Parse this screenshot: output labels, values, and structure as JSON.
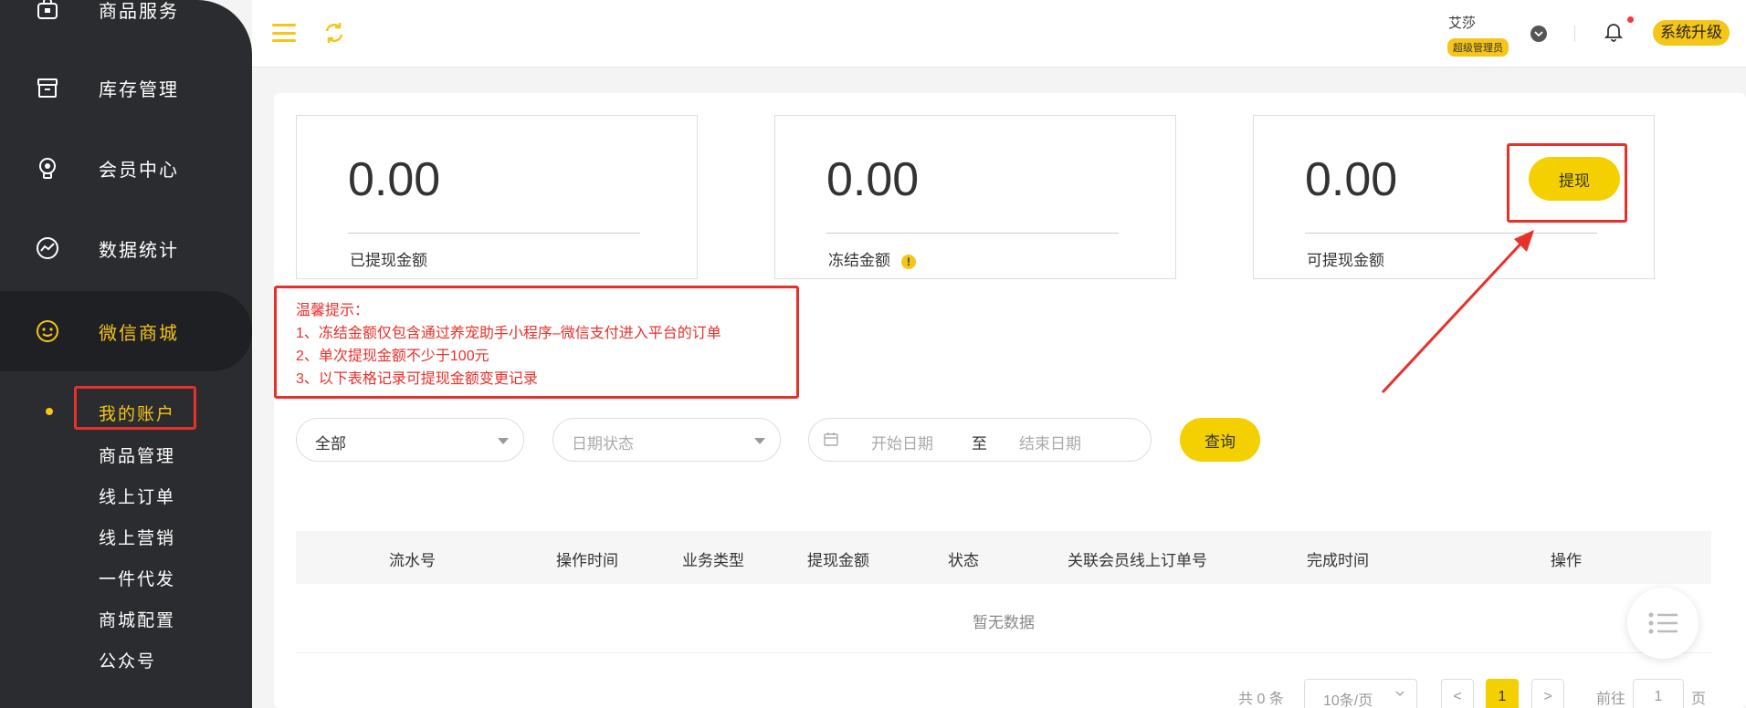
{
  "sidebar": {
    "items": [
      {
        "label": "商品服务",
        "icon": "bag-icon"
      },
      {
        "label": "库存管理",
        "icon": "inventory-icon"
      },
      {
        "label": "会员中心",
        "icon": "member-icon"
      },
      {
        "label": "数据统计",
        "icon": "chart-icon"
      },
      {
        "label": "微信商城",
        "icon": "wechat-icon"
      }
    ],
    "sub_items": [
      {
        "label": "我的账户"
      },
      {
        "label": "商品管理"
      },
      {
        "label": "线上订单"
      },
      {
        "label": "线上营销"
      },
      {
        "label": "一件代发"
      },
      {
        "label": "商城配置"
      },
      {
        "label": "公众号"
      }
    ]
  },
  "header": {
    "user_name": "艾莎",
    "user_role": "超级管理员",
    "upgrade_label": "系统升级"
  },
  "cards": [
    {
      "amount": "0.00",
      "label": "已提现金额"
    },
    {
      "amount": "0.00",
      "label": "冻结金额"
    },
    {
      "amount": "0.00",
      "label": "可提现金额"
    }
  ],
  "withdraw_label": "提现",
  "notice": {
    "title": "温馨提示：",
    "lines": [
      "1、冻结金额仅包含通过养宠助手小程序–微信支付进入平台的订单",
      "2、单次提现金额不少于100元",
      "3、以下表格记录可提现金额变更记录"
    ]
  },
  "filters": {
    "type_value": "全部",
    "date_status_placeholder": "日期状态",
    "start_date_placeholder": "开始日期",
    "to_label": "至",
    "end_date_placeholder": "结束日期",
    "query_label": "查询"
  },
  "table": {
    "columns": [
      "流水号",
      "操作时间",
      "业务类型",
      "提现金额",
      "状态",
      "关联会员线上订单号",
      "完成时间",
      "操作"
    ],
    "empty_text": "暂无数据"
  },
  "pagination": {
    "total": "共 0 条",
    "page_size": "10条/页",
    "prev": "<",
    "current": "1",
    "next": ">",
    "goto_label": "前往",
    "goto_value": "1",
    "page_suffix": "页"
  },
  "colors": {
    "accent": "#f5c518",
    "sidebar_bg": "#2b2c30",
    "annotation_red": "#e8302a"
  }
}
